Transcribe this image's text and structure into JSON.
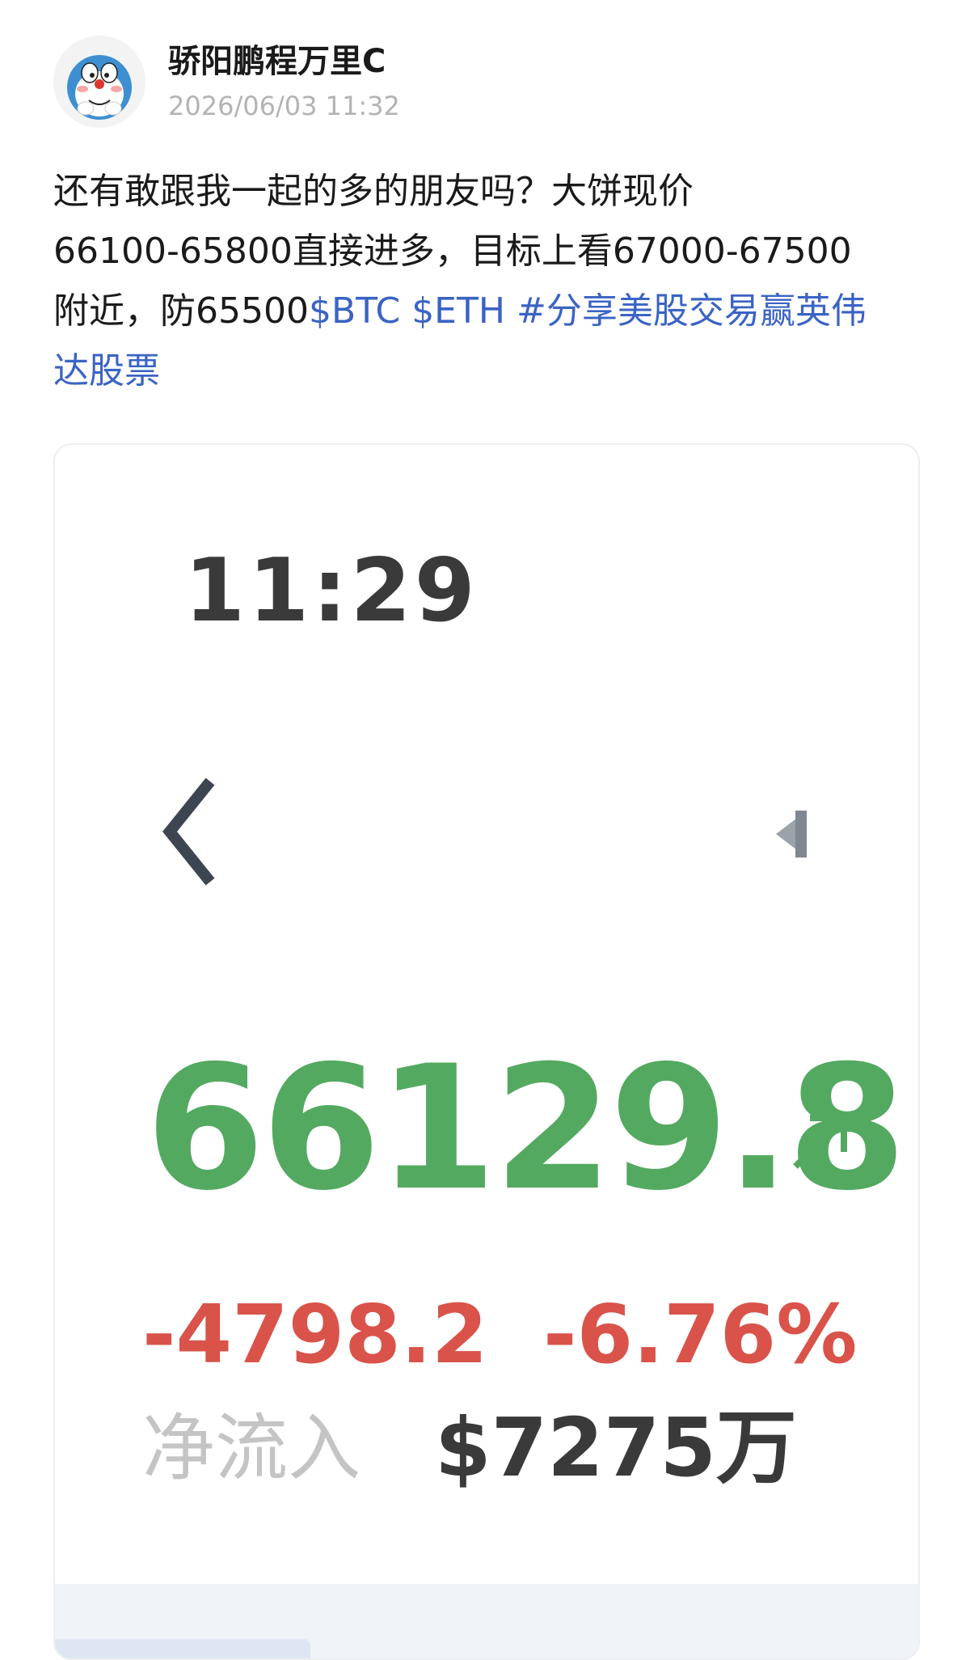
{
  "author": {
    "name": "骄阳鹏程万里C",
    "time": "2026/06/03 11:32",
    "avatar_icon": "doraemon-avatar-icon"
  },
  "post": {
    "line1": "还有敢跟我一起的多的朋友吗？大饼现价",
    "line2": "66100-65800直接进多，目标上看67000-67500",
    "line3_text": "附近，防65500",
    "tag_btc": "$BTC",
    "tag_eth": "$ETH",
    "hashtag_part1": "#分享美股交易赢英伟",
    "hashtag_part2": "达股票"
  },
  "card": {
    "time": "11:29",
    "back_icon": "chevron-left-icon",
    "side_icon": "triangle-left-icon",
    "price": "66129.8",
    "trend_icon": "arrow-up-right-icon",
    "change_abs": "-4798.2",
    "change_pct": "-6.76%",
    "inflow_label": "净流入",
    "inflow_value": "$7275万"
  },
  "colors": {
    "link": "#3a63c4",
    "price_green": "#54a961",
    "change_red": "#d9534a",
    "muted_gray": "#b3b3b3"
  }
}
